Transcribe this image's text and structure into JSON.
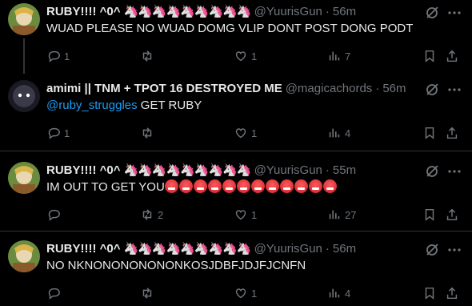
{
  "tweets": [
    {
      "name": "RUBY!!!! ^0^",
      "emojis": "🦄🦄🦄🦄🦄🦄🦄🦄🦄",
      "handle": "@YuurisGun",
      "time": "56m",
      "text": "WUAD PLEASE NO WUAD DOMG VLIP DONT POST DONG PODT",
      "replies": "1",
      "retweets": "",
      "likes": "1",
      "views": "7"
    },
    {
      "name": "amimi || TNM + TPOT 16 DESTROYED ME",
      "emojis": "",
      "handle": "@magicachords",
      "time": "56m",
      "mention": "@ruby_struggles",
      "text": " GET RUBY",
      "replies": "1",
      "retweets": "",
      "likes": "1",
      "views": "4"
    },
    {
      "name": "RUBY!!!! ^0^",
      "emojis": "🦄🦄🦄🦄🦄🦄🦄🦄🦄",
      "handle": "@YuurisGun",
      "time": "55m",
      "text": "IM OUT TO GET YOU",
      "angry_emoji": "🤬",
      "angry_count": 12,
      "replies": "",
      "retweets": "2",
      "likes": "1",
      "views": "27"
    },
    {
      "name": "RUBY!!!! ^0^",
      "emojis": "🦄🦄🦄🦄🦄🦄🦄🦄🦄",
      "handle": "@YuurisGun",
      "time": "56m",
      "text": "NO NKNONONONONONKOSJDBFJDJFJCNFN",
      "replies": "",
      "retweets": "",
      "likes": "1",
      "views": "4"
    }
  ],
  "separator": "·",
  "colors": {
    "accent": "#1d9bf0",
    "muted": "#71767b",
    "text": "#e7e9ea",
    "background": "#000000"
  }
}
